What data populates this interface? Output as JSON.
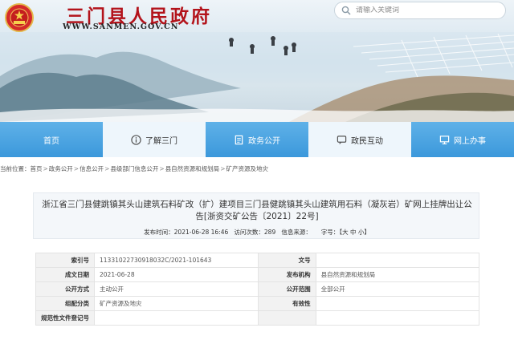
{
  "header": {
    "title": "三门县人民政府",
    "domain": "WWW.SANMEN.GOV.CN",
    "emblem_icon": "national-emblem-icon"
  },
  "search": {
    "placeholder": "请输入关键词"
  },
  "nav": {
    "items": [
      {
        "label": "首页",
        "icon": ""
      },
      {
        "label": "了解三门",
        "icon": "info-icon"
      },
      {
        "label": "政务公开",
        "icon": "document-icon"
      },
      {
        "label": "政民互动",
        "icon": "chat-icon"
      },
      {
        "label": "网上办事",
        "icon": "monitor-icon"
      }
    ]
  },
  "breadcrumb": {
    "label": "当前位置：",
    "items": [
      "首页",
      "政务公开",
      "信息公开",
      "县级部门信息公开",
      "县自然资源和规划局",
      "矿产资源及地灾"
    ]
  },
  "article": {
    "title": "浙江省三门县健跳镇其头山建筑石料矿改（扩）建项目三门县健跳镇其头山建筑用石料（凝灰岩）矿网上挂牌出让公告[浙资交矿公告〔2021〕22号]",
    "meta": {
      "publish_label": "发布时间：",
      "publish_time": "2021-06-28 16:46",
      "views_label": "访问次数：",
      "views": "289",
      "source_label": "信息来源：",
      "source": "",
      "font_label": "字号：",
      "font_open": "【",
      "font_large": "大",
      "font_medium": "中",
      "font_small": "小",
      "font_close": "】"
    }
  },
  "info_table": {
    "index_label": "索引号",
    "index_value": "11331022730918032C/2021-101643",
    "docno_label": "文号",
    "docno_value": "",
    "date_label": "成文日期",
    "date_value": "2021-06-28",
    "org_label": "发布机构",
    "org_value": "县自然资源和规划局",
    "mode_label": "公开方式",
    "mode_value": "主动公开",
    "scope_label": "公开范围",
    "scope_value": "全部公开",
    "category_label": "组配分类",
    "category_value": "矿产资源及地灾",
    "validity_label": "有效性",
    "validity_value": "",
    "regno_label": "规范性文件登记号",
    "regno_value": ""
  },
  "colors": {
    "title_red": "#b3131b",
    "nav_blue": "#3b98db",
    "nav_light": "#eef6fc"
  }
}
